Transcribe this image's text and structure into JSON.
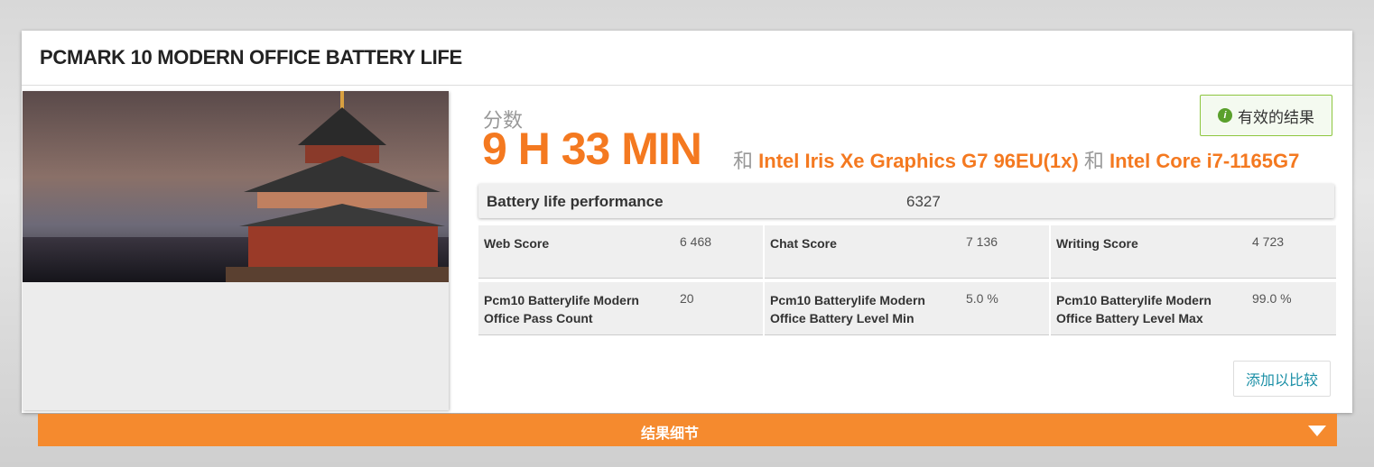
{
  "card": {
    "title": "PCMARK 10 MODERN OFFICE BATTERY LIFE"
  },
  "score": {
    "label": "分数",
    "value": "9 H 33 MIN",
    "and1": "和",
    "gpu": "Intel Iris Xe Graphics G7 96EU(1x)",
    "and2": "和",
    "cpu": "Intel Core i7-1165G7"
  },
  "valid_badge": {
    "icon": "info-icon",
    "label": "有效的结果"
  },
  "performance": {
    "name": "Battery life performance",
    "value": "6327"
  },
  "subscores": [
    {
      "name": "Web Score",
      "value": "6 468"
    },
    {
      "name": "Chat Score",
      "value": "7 136"
    },
    {
      "name": "Writing Score",
      "value": "4 723"
    },
    {
      "name": "Pcm10 Batterylife Modern Office Pass Count",
      "value": "20"
    },
    {
      "name": "Pcm10 Batterylife Modern Office Battery Level Min",
      "value": "5.0 %"
    },
    {
      "name": "Pcm10 Batterylife Modern Office Battery Level Max",
      "value": "99.0 %"
    }
  ],
  "compare_button": "添加以比较",
  "details_bar": {
    "label": "结果细节",
    "icon": "chevron-down-icon"
  },
  "colors": {
    "accent": "#f47920",
    "valid": "#8dc63f",
    "link": "#1a8fa6"
  }
}
